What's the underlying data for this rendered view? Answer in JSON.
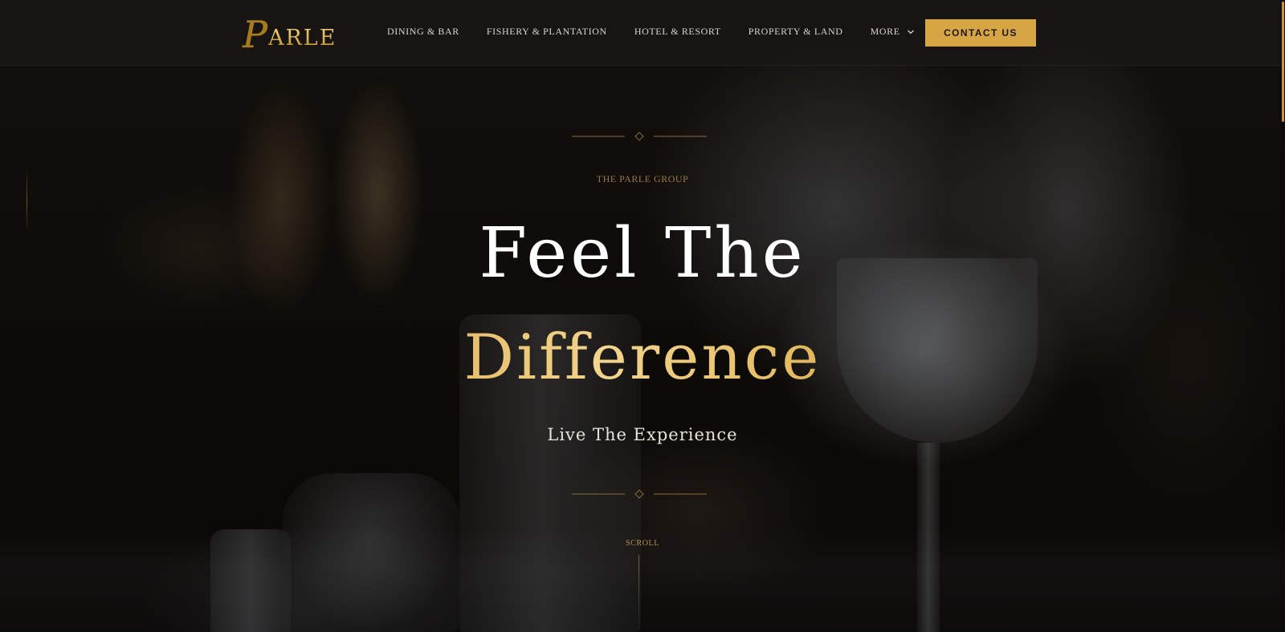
{
  "brand": {
    "logo_initial": "P",
    "logo_rest": "ARLE",
    "accent_color": "#d8a545"
  },
  "nav": {
    "items": [
      {
        "label": "DINING & BAR"
      },
      {
        "label": "FISHERY & PLANTATION"
      },
      {
        "label": "HOTEL & RESORT"
      },
      {
        "label": "PROPERTY & LAND"
      },
      {
        "label": "MORE",
        "icon": "chevron-down-icon"
      }
    ],
    "contact_label": "CONTACT US"
  },
  "hero": {
    "eyebrow": "THE PARLE GROUP",
    "headline_line1": "Feel The",
    "headline_line2": "Difference",
    "tagline": "Live The Experience",
    "scroll_label": "SCROLL"
  }
}
